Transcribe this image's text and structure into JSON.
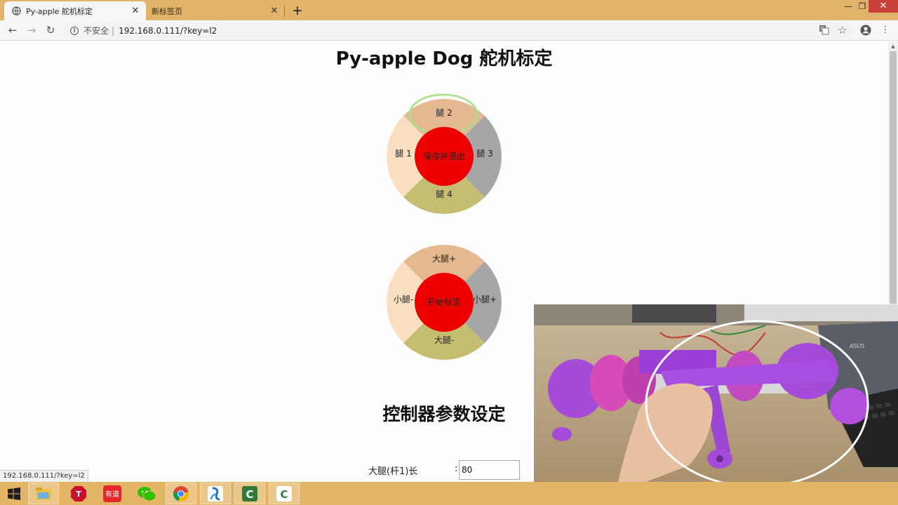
{
  "browser": {
    "tabs": [
      {
        "title": "Py-apple 舵机标定",
        "active": true
      },
      {
        "title": "新标签页",
        "active": false
      }
    ],
    "security_label": "不安全",
    "url": "192.168.0.111/?key=l2",
    "window_controls": {
      "minimize": "—",
      "maximize": "❐",
      "close": "✕"
    }
  },
  "page": {
    "title": "Py-apple Dog 舵机标定",
    "leg_pad": {
      "top": "腿 2",
      "left": "腿 1",
      "right": "腿 3",
      "bottom": "腿 4",
      "center": "保存并退出"
    },
    "joint_pad": {
      "top": "大腿+",
      "left": "小腿-",
      "right": "小腿+",
      "bottom": "大腿-",
      "center": "开始标定"
    },
    "controller_title": "控制器参数设定",
    "params": [
      {
        "label": "大腿(杆1)长",
        "value": "80"
      }
    ]
  },
  "status_tooltip": "192.168.0.111/?key=l2",
  "colors": {
    "pad_top": "#e5b98f",
    "pad_left": "#f9dfbf",
    "pad_right": "#a6a6a6",
    "pad_bottom": "#c4bf70",
    "pad_center": "#ee0000",
    "highlight": "#a6e08a"
  },
  "taskbar": {
    "items": [
      "windows-start-icon",
      "file-explorer-icon",
      "typora-icon",
      "youdao-icon",
      "wechat-icon",
      "chrome-icon",
      "python-icon",
      "camtasia-icon",
      "camtasia-recorder-icon"
    ]
  }
}
